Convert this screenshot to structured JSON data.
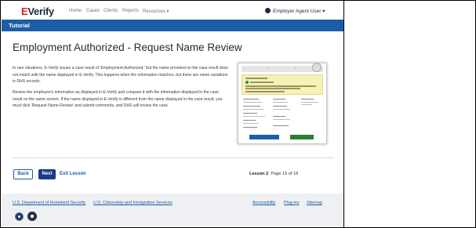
{
  "nav": {
    "logo_prefix": "E",
    "logo_rest": "Verify",
    "links": [
      "Home",
      "Cases",
      "Clients",
      "Reports",
      "Resources ▾"
    ],
    "user_label": "Employer Agent User ▾"
  },
  "banner": {
    "title": "Tutorial"
  },
  "content": {
    "title": "Employment Authorized - Request Name Review",
    "paragraph1": "In rare situations, E-Verify issues a case result of 'Employment Authorized,' but the name provided on the case result does not match with the name displayed in E-Verify. This happens when the information matches, but there are name variations in DHS records.",
    "paragraph2": "Review the employee's information as displayed in E-Verify and compare it with the information displayed in the case result on the same screen. If the name displayed in E-Verify is different from the name displayed in the case result, you must click 'Request Name Review' and submit comments, and DHS will review the case."
  },
  "controls": {
    "back_label": "Back",
    "next_label": "Next",
    "exit_label": "Exit Lesson",
    "lesson_label": "Lesson 2",
    "page_label": "Page 15 of 18"
  },
  "footer": {
    "links": [
      "U.S. Department of Homeland Security",
      "U.S. Citizenship and Immigration Services"
    ],
    "right_links": [
      "Accessibility",
      "Plug-ins",
      "Sitemap"
    ]
  },
  "colors": {
    "brand_blue": "#1b5ea6",
    "next_button": "#1b3b8a",
    "logo_red": "#d2232a"
  }
}
